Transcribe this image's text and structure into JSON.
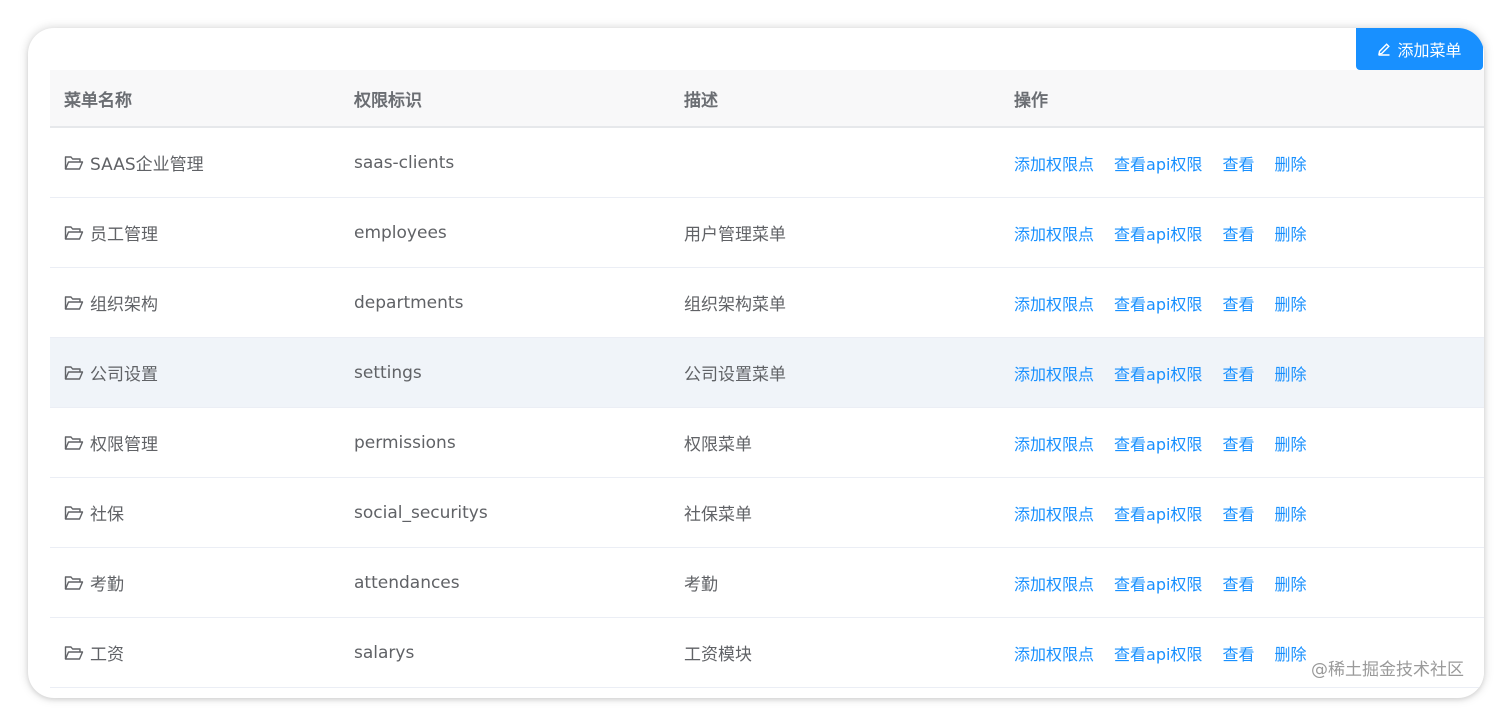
{
  "toolbar": {
    "add_menu_label": "添加菜单"
  },
  "table": {
    "headers": [
      "菜单名称",
      "权限标识",
      "描述",
      "操作"
    ],
    "operations": [
      "添加权限点",
      "查看api权限",
      "查看",
      "删除"
    ],
    "rows": [
      {
        "name": "SAAS企业管理",
        "code": "saas-clients",
        "desc": ""
      },
      {
        "name": "员工管理",
        "code": "employees",
        "desc": "用户管理菜单"
      },
      {
        "name": "组织架构",
        "code": "departments",
        "desc": "组织架构菜单"
      },
      {
        "name": "公司设置",
        "code": "settings",
        "desc": "公司设置菜单"
      },
      {
        "name": "权限管理",
        "code": "permissions",
        "desc": "权限菜单"
      },
      {
        "name": "社保",
        "code": "social_securitys",
        "desc": "社保菜单"
      },
      {
        "name": "考勤",
        "code": "attendances",
        "desc": "考勤"
      },
      {
        "name": "工资",
        "code": "salarys",
        "desc": "工资模块"
      }
    ]
  },
  "watermark": "@稀土掘金技术社区",
  "colors": {
    "primary": "#1890ff",
    "header_bg": "#f8f8f9",
    "hover_row_bg": "#f0f4f9"
  },
  "icons": {
    "row_icon": "folder-open-icon",
    "button_icon": "edit-icon"
  }
}
